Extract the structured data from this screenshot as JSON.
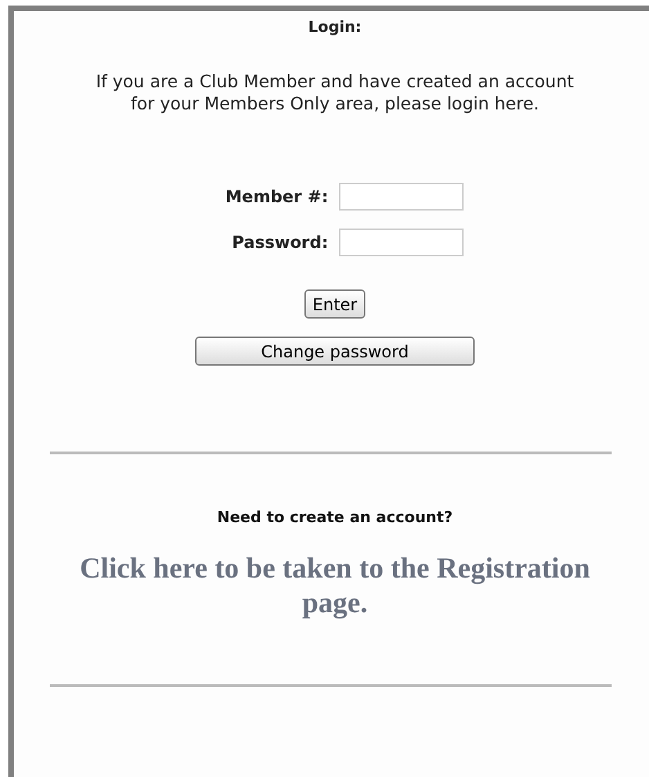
{
  "title": "Login:",
  "intro": "If you are a Club Member and have created an account for your Members Only area, please login here.",
  "fields": [
    {
      "label": "Member #:"
    },
    {
      "label": "Password:"
    }
  ],
  "buttons": [
    "Enter",
    "Change password"
  ],
  "register_prompt": "Need to create an account?",
  "register_link": "Click here to be taken to the Registration page."
}
